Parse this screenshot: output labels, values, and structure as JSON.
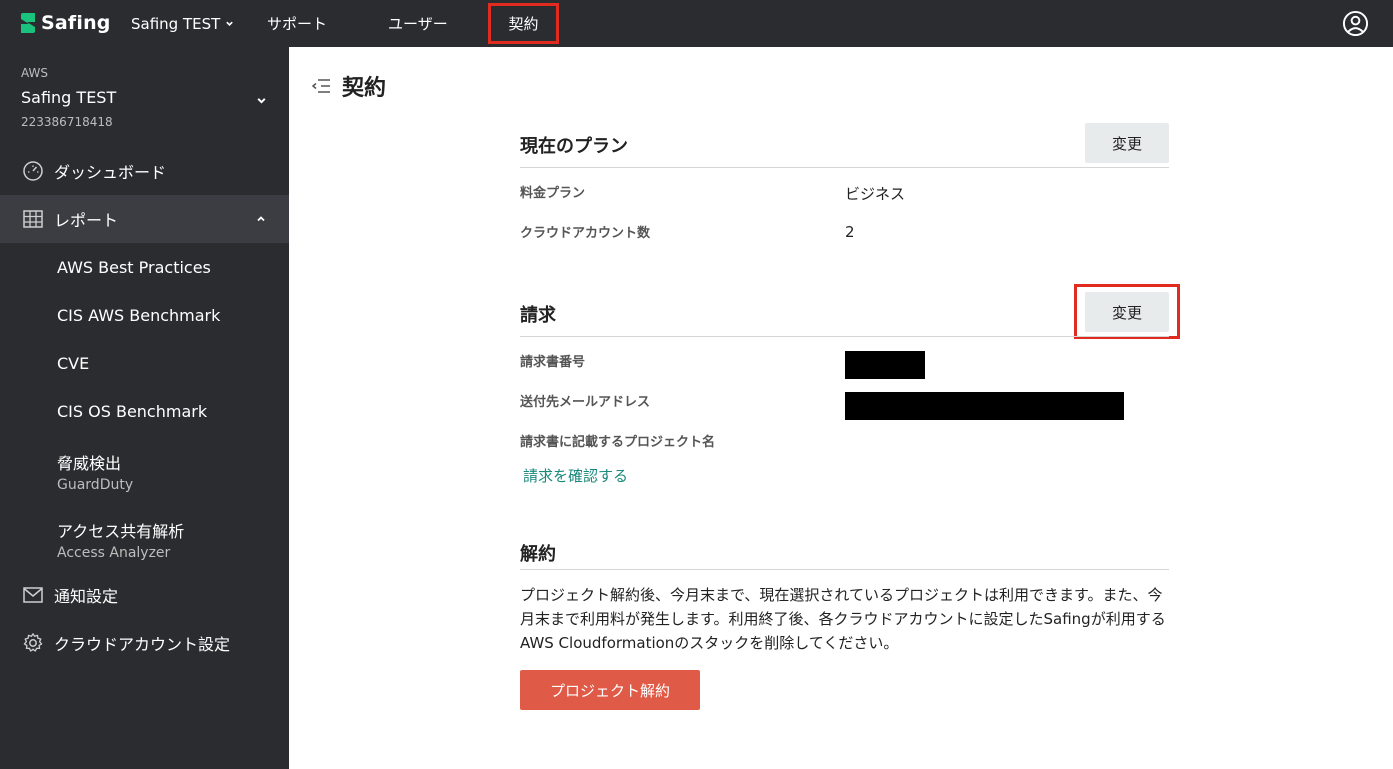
{
  "brand": {
    "name": "Safing",
    "accent": "#1a8a7c",
    "highlight": "#e22b1f",
    "danger": "#e05b47"
  },
  "topnav": {
    "project_label": "Safing TEST",
    "items": [
      {
        "label": "サポート"
      },
      {
        "label": "ユーザー"
      },
      {
        "label": "契約",
        "highlighted": true
      }
    ],
    "account_icon": "user-circle-icon"
  },
  "sidebar": {
    "project": {
      "cloud": "AWS",
      "name": "Safing TEST",
      "id": "223386718418"
    },
    "items": [
      {
        "label": "ダッシュボード",
        "icon": "gauge-icon"
      },
      {
        "label": "レポート",
        "icon": "grid-icon",
        "expanded": true
      }
    ],
    "report_items": [
      {
        "label": "AWS Best Practices"
      },
      {
        "label": "CIS AWS Benchmark"
      },
      {
        "label": "CVE"
      },
      {
        "label": "CIS OS Benchmark"
      },
      {
        "label": "脅威検出",
        "sublabel": "GuardDuty"
      },
      {
        "label": "アクセス共有解析",
        "sublabel": "Access Analyzer"
      }
    ],
    "bottom_items": [
      {
        "label": "通知設定",
        "icon": "mail-icon"
      },
      {
        "label": "クラウドアカウント設定",
        "icon": "gear-icon"
      }
    ]
  },
  "main": {
    "title": "契約",
    "plan": {
      "title": "現在のプラン",
      "change_label": "変更",
      "rows": [
        {
          "label": "料金プラン",
          "value": "ビジネス"
        },
        {
          "label": "クラウドアカウント数",
          "value": "2"
        }
      ]
    },
    "billing": {
      "title": "請求",
      "change_label": "変更",
      "rows": [
        {
          "label": "請求書番号",
          "value": "",
          "redacted": true
        },
        {
          "label": "送付先メールアドレス",
          "value": "",
          "redacted": true
        },
        {
          "label": "請求書に記載するプロジェクト名",
          "value": ""
        }
      ],
      "link_label": "請求を確認する"
    },
    "cancel": {
      "title": "解約",
      "description": "プロジェクト解約後、今月末まで、現在選択されているプロジェクトは利用できます。また、今月末まで利用料が発生します。利用終了後、各クラウドアカウントに設定したSafingが利用するAWS Cloudformationのスタックを削除してください。",
      "button_label": "プロジェクト解約"
    }
  }
}
